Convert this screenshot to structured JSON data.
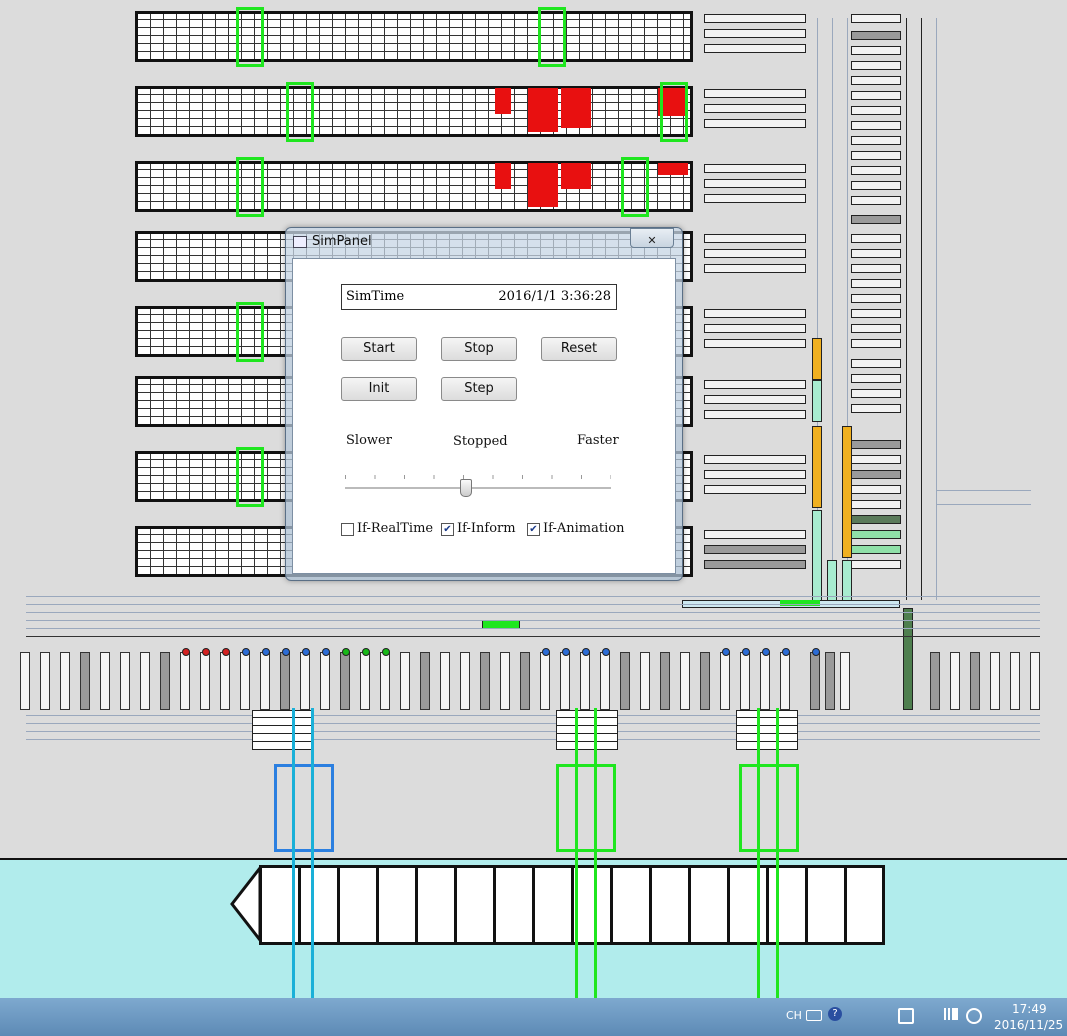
{
  "sim_panel": {
    "title": "SimPanel",
    "close_glyph": "✕",
    "simtime_label": "SimTime",
    "simtime_value": "2016/1/1 3:36:28",
    "buttons": {
      "start": "Start",
      "stop": "Stop",
      "reset": "Reset",
      "init": "Init",
      "step": "Step"
    },
    "speed": {
      "slower": "Slower",
      "status": "Stopped",
      "faster": "Faster",
      "position": 0.45
    },
    "options": {
      "realtime": {
        "label": "If-RealTime",
        "checked": false
      },
      "inform": {
        "label": "If-Inform",
        "checked": true
      },
      "animation": {
        "label": "If-Animation",
        "checked": true
      }
    }
  },
  "taskbar": {
    "ime": "CH",
    "time": "17:49",
    "date": "2016/11/25"
  },
  "colors": {
    "background": "#dcdcdc",
    "sea": "#b1ecec",
    "crane_frame": "#1fe61f",
    "active_crane": "#2b7fe0",
    "occupied_block": "#e81010",
    "agv_path": "#f0b020"
  },
  "icons": [
    "window-icon",
    "close-icon",
    "keyboard-icon",
    "help-icon",
    "network-icon",
    "volume-muted-icon",
    "signal-icon"
  ]
}
